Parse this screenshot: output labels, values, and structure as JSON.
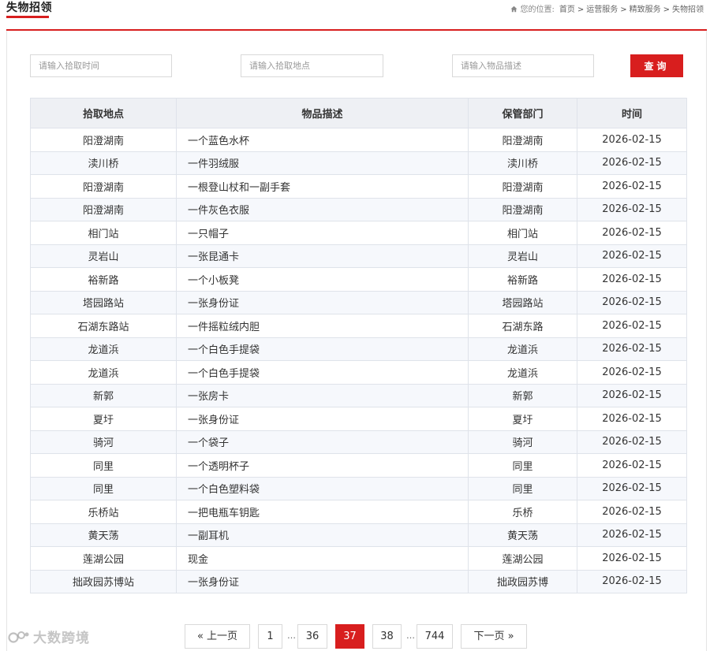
{
  "header": {
    "page_title": "失物招领",
    "breadcrumb_label": "您的位置:",
    "breadcrumb": [
      "首页",
      "运营服务",
      "精致服务",
      "失物招领"
    ]
  },
  "search": {
    "time_placeholder": "请输入拾取时间",
    "place_placeholder": "请输入拾取地点",
    "desc_placeholder": "请输入物品描述",
    "button_label": "查询"
  },
  "table": {
    "columns": [
      "拾取地点",
      "物品描述",
      "保管部门",
      "时间"
    ],
    "rows": [
      [
        "阳澄湖南",
        "一个蓝色水杯",
        "阳澄湖南",
        "2026-02-15"
      ],
      [
        "渎川桥",
        "一件羽绒服",
        "渎川桥",
        "2026-02-15"
      ],
      [
        "阳澄湖南",
        "一根登山杖和一副手套",
        "阳澄湖南",
        "2026-02-15"
      ],
      [
        "阳澄湖南",
        "一件灰色衣服",
        "阳澄湖南",
        "2026-02-15"
      ],
      [
        "相门站",
        "一只帽子",
        "相门站",
        "2026-02-15"
      ],
      [
        "灵岩山",
        "一张昆通卡",
        "灵岩山",
        "2026-02-15"
      ],
      [
        "裕新路",
        "一个小板凳",
        "裕新路",
        "2026-02-15"
      ],
      [
        "塔园路站",
        "一张身份证",
        "塔园路站",
        "2026-02-15"
      ],
      [
        "石湖东路站",
        "一件摇粒绒内胆",
        "石湖东路",
        "2026-02-15"
      ],
      [
        "龙道浜",
        "一个白色手提袋",
        "龙道浜",
        "2026-02-15"
      ],
      [
        "龙道浜",
        "一个白色手提袋",
        "龙道浜",
        "2026-02-15"
      ],
      [
        "新郭",
        "一张房卡",
        "新郭",
        "2026-02-15"
      ],
      [
        "夏圩",
        "一张身份证",
        "夏圩",
        "2026-02-15"
      ],
      [
        "骑河",
        "一个袋子",
        "骑河",
        "2026-02-15"
      ],
      [
        "同里",
        "一个透明杯子",
        "同里",
        "2026-02-15"
      ],
      [
        "同里",
        "一个白色塑料袋",
        "同里",
        "2026-02-15"
      ],
      [
        "乐桥站",
        "一把电瓶车钥匙",
        "乐桥",
        "2026-02-15"
      ],
      [
        "黄天荡",
        "一副耳机",
        "黄天荡",
        "2026-02-15"
      ],
      [
        "莲湖公园",
        "现金",
        "莲湖公园",
        "2026-02-15"
      ],
      [
        "拙政园苏博站",
        "一张身份证",
        "拙政园苏博",
        "2026-02-15"
      ]
    ]
  },
  "pagination": {
    "prev_label": "« 上一页",
    "pages": [
      "1",
      "…",
      "36",
      "37",
      "38",
      "…",
      "744"
    ],
    "current_page": "37",
    "next_label": "下一页 »"
  },
  "watermark": {
    "text": "大数跨境"
  },
  "colors": {
    "accent": "#d81e1e",
    "header_bg": "#eef0f4",
    "stripe_bg": "#f6f8fc"
  }
}
